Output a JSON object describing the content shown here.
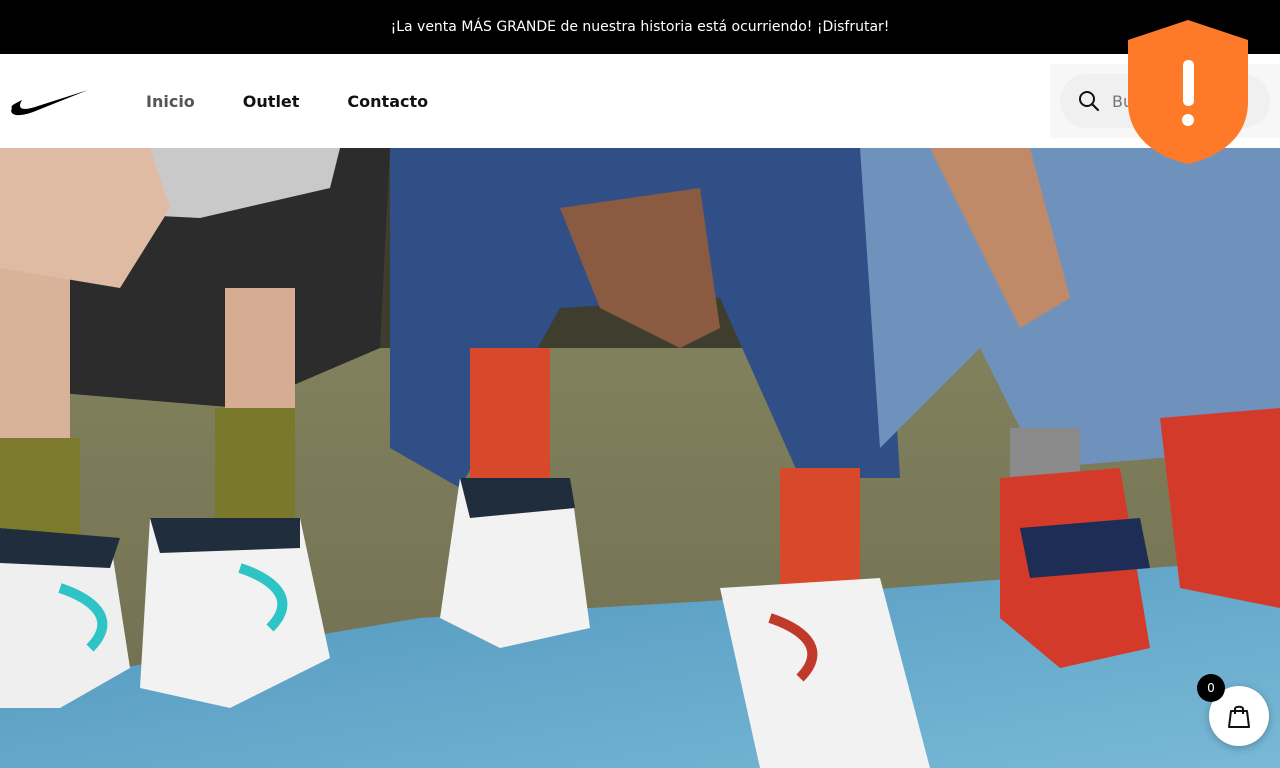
{
  "announcement": {
    "text": "¡La venta MÁS GRANDE de nuestra historia está ocurriendo! ¡Disfrutar!"
  },
  "brand": {
    "logo_icon": "swoosh-logo-icon"
  },
  "nav": {
    "items": [
      {
        "label": "Inicio"
      },
      {
        "label": "Outlet"
      },
      {
        "label": "Contacto"
      }
    ]
  },
  "search": {
    "placeholder": "Buscar",
    "icon": "search-icon"
  },
  "alert": {
    "icon": "shield-warning-icon",
    "color": "#ff7a28"
  },
  "hero": {
    "image": "sneakers-photo",
    "colors": {
      "sky": "#6aa9c8",
      "teal": "#2ec4c6",
      "red": "#d5402c"
    }
  },
  "cart": {
    "count": "0",
    "icon": "shopping-bag-icon"
  }
}
